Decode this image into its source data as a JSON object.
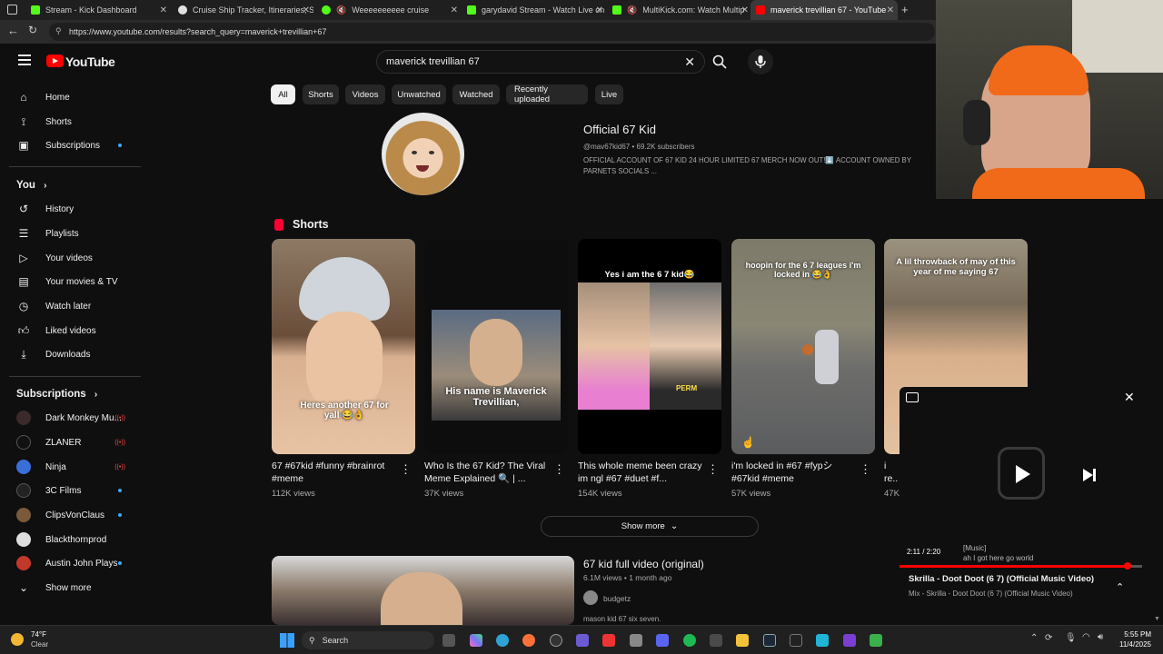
{
  "browser": {
    "tabs": [
      {
        "title": "Stream - Kick Dashboard",
        "color": "#53fc18"
      },
      {
        "title": "Cruise Ship Tracker, Itineraries, Sc",
        "color": "#e0e0e0"
      },
      {
        "title": "Weeeeeeeeee cruise",
        "color": "#53fc18"
      },
      {
        "title": "garydavid Stream - Watch Live on",
        "color": "#53fc18"
      },
      {
        "title": "MultiKick.com: Watch Multip",
        "color": "#53fc18"
      },
      {
        "title": "maverick trevillian 67 - YouTube",
        "color": "#ff0000"
      }
    ],
    "url": "https://www.youtube.com/results?search_query=maverick+trevillian+67"
  },
  "youtube": {
    "logo_text": "YouTube",
    "search_value": "maverick trevillian 67",
    "chips": [
      "All",
      "Shorts",
      "Videos",
      "Unwatched",
      "Watched",
      "Recently uploaded",
      "Live"
    ],
    "sidebar": {
      "main": [
        {
          "label": "Home",
          "icon": "home-icon"
        },
        {
          "label": "Shorts",
          "icon": "shorts-icon"
        },
        {
          "label": "Subscriptions",
          "icon": "subscriptions-icon"
        }
      ],
      "you_header": "You",
      "you_items": [
        {
          "label": "History",
          "icon": "history-icon"
        },
        {
          "label": "Playlists",
          "icon": "playlists-icon"
        },
        {
          "label": "Your videos",
          "icon": "your-videos-icon"
        },
        {
          "label": "Your movies & TV",
          "icon": "movies-icon"
        },
        {
          "label": "Watch later",
          "icon": "clock-icon"
        },
        {
          "label": "Liked videos",
          "icon": "thumbs-up-icon"
        },
        {
          "label": "Downloads",
          "icon": "download-icon"
        }
      ],
      "subs_header": "Subscriptions",
      "subs": [
        {
          "label": "Dark Monkey Mu...",
          "status": "live",
          "color": "#3b2a2a"
        },
        {
          "label": "ZLANER",
          "status": "live",
          "color": "#111111"
        },
        {
          "label": "Ninja",
          "status": "live",
          "color": "#3a6fd8"
        },
        {
          "label": "3C Films",
          "status": "new",
          "color": "#222222"
        },
        {
          "label": "ClipsVonClaus",
          "status": "new",
          "color": "#7a5a3a"
        },
        {
          "label": "Blackthornprod",
          "status": "",
          "color": "#dddddd"
        },
        {
          "label": "Austin John Plays",
          "status": "new",
          "color": "#c0392b"
        }
      ],
      "show_more": "Show more"
    },
    "channel": {
      "name": "Official 67 Kid",
      "handle_subs": "@mav67kid67 • 69.2K subscribers",
      "description": "OFFICIAL ACCOUNT OF 67 KID 24 HOUR LIMITED 67 MERCH NOW OUT!⬇️ ACCOUNT OWNED BY PARNETS SOCIALS ..."
    },
    "shorts_header": "Shorts",
    "shorts": [
      {
        "title": "67 #67kid #funny #brainrot #meme",
        "views": "112K views",
        "overlay": "Heres another 67 for yall 😂👌"
      },
      {
        "title": "Who Is the 67 Kid? The Viral Meme Explained 🔍 | ...",
        "views": "37K views",
        "overlay": "His name is Maverick Trevillian,"
      },
      {
        "title": "This whole meme been crazy im ngl #67 #duet #f...",
        "views": "154K views",
        "overlay": "Yes i am the 6 7 kid😂"
      },
      {
        "title": "i'm locked in #67 #fypシ #67kid #meme",
        "views": "57K views",
        "overlay": "hoopin for the 6 7 leagues i'm locked in 😂👌"
      },
      {
        "title": "i re... pho...",
        "views": "47K",
        "overlay": "A lil throwback of may of this year of me saying 67"
      }
    ],
    "shorts_overlay_extra": {
      "perm": "PERM"
    },
    "show_more_btn": "Show more",
    "video": {
      "title": "67 kid full video (original)",
      "meta": "6.1M views • 1 month ago",
      "channel": "budgetz",
      "snippet": "mason kid 67 six seven."
    }
  },
  "miniplayer": {
    "time": "2:11 / 2:20",
    "caption_tag": "[Music]",
    "caption_text": "ah I got here go world",
    "title": "Skrilla - Doot Doot (6 7) (Official Music Video)",
    "subtitle": "Mix - Skrilla - Doot Doot (6 7) (Official Music Video)",
    "progress": 0.94
  },
  "taskbar": {
    "weather_temp": "74°F",
    "weather_desc": "Clear",
    "search_label": "Search",
    "time": "5:55 PM",
    "date": "11/4/2025"
  }
}
